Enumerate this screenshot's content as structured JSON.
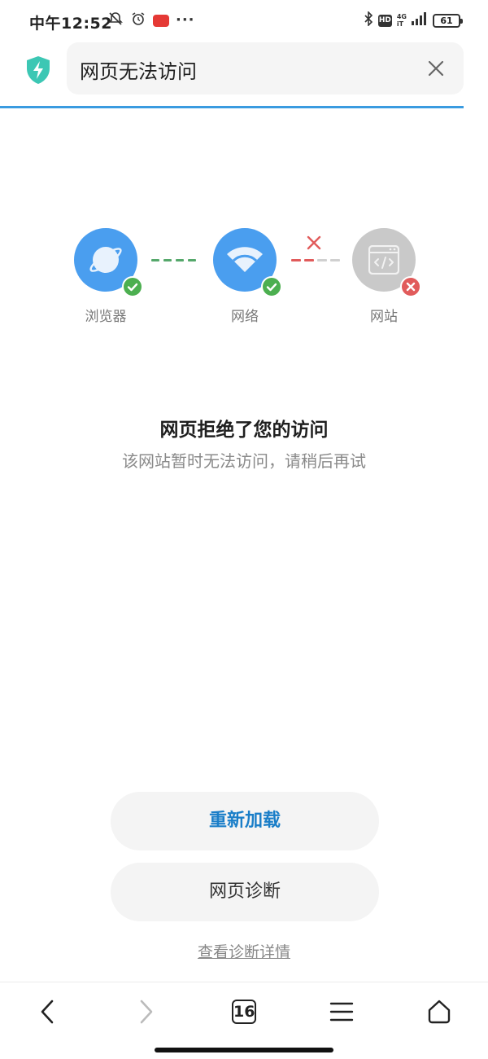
{
  "status_bar": {
    "time": "中午12:52",
    "network_label_top": "4G",
    "network_label_bottom": "iT",
    "hd_label": "HD",
    "battery": "61",
    "more": "···"
  },
  "address_bar": {
    "title": "网页无法访问"
  },
  "diagnostics": {
    "nodes": [
      {
        "label": "浏览器",
        "status": "ok"
      },
      {
        "label": "网络",
        "status": "ok"
      },
      {
        "label": "网站",
        "status": "error"
      }
    ],
    "colors": {
      "node_blue": "#4a9eef",
      "node_gray": "#c9c9c9",
      "ok_green": "#4caf50",
      "error_red": "#e15b5b"
    }
  },
  "message": {
    "title": "网页拒绝了您的访问",
    "subtitle": "该网站暂时无法访问，请稍后再试"
  },
  "actions": {
    "reload": "重新加载",
    "diagnose": "网页诊断",
    "details": "查看诊断详情"
  },
  "bottom_nav": {
    "tab_count": "16"
  }
}
